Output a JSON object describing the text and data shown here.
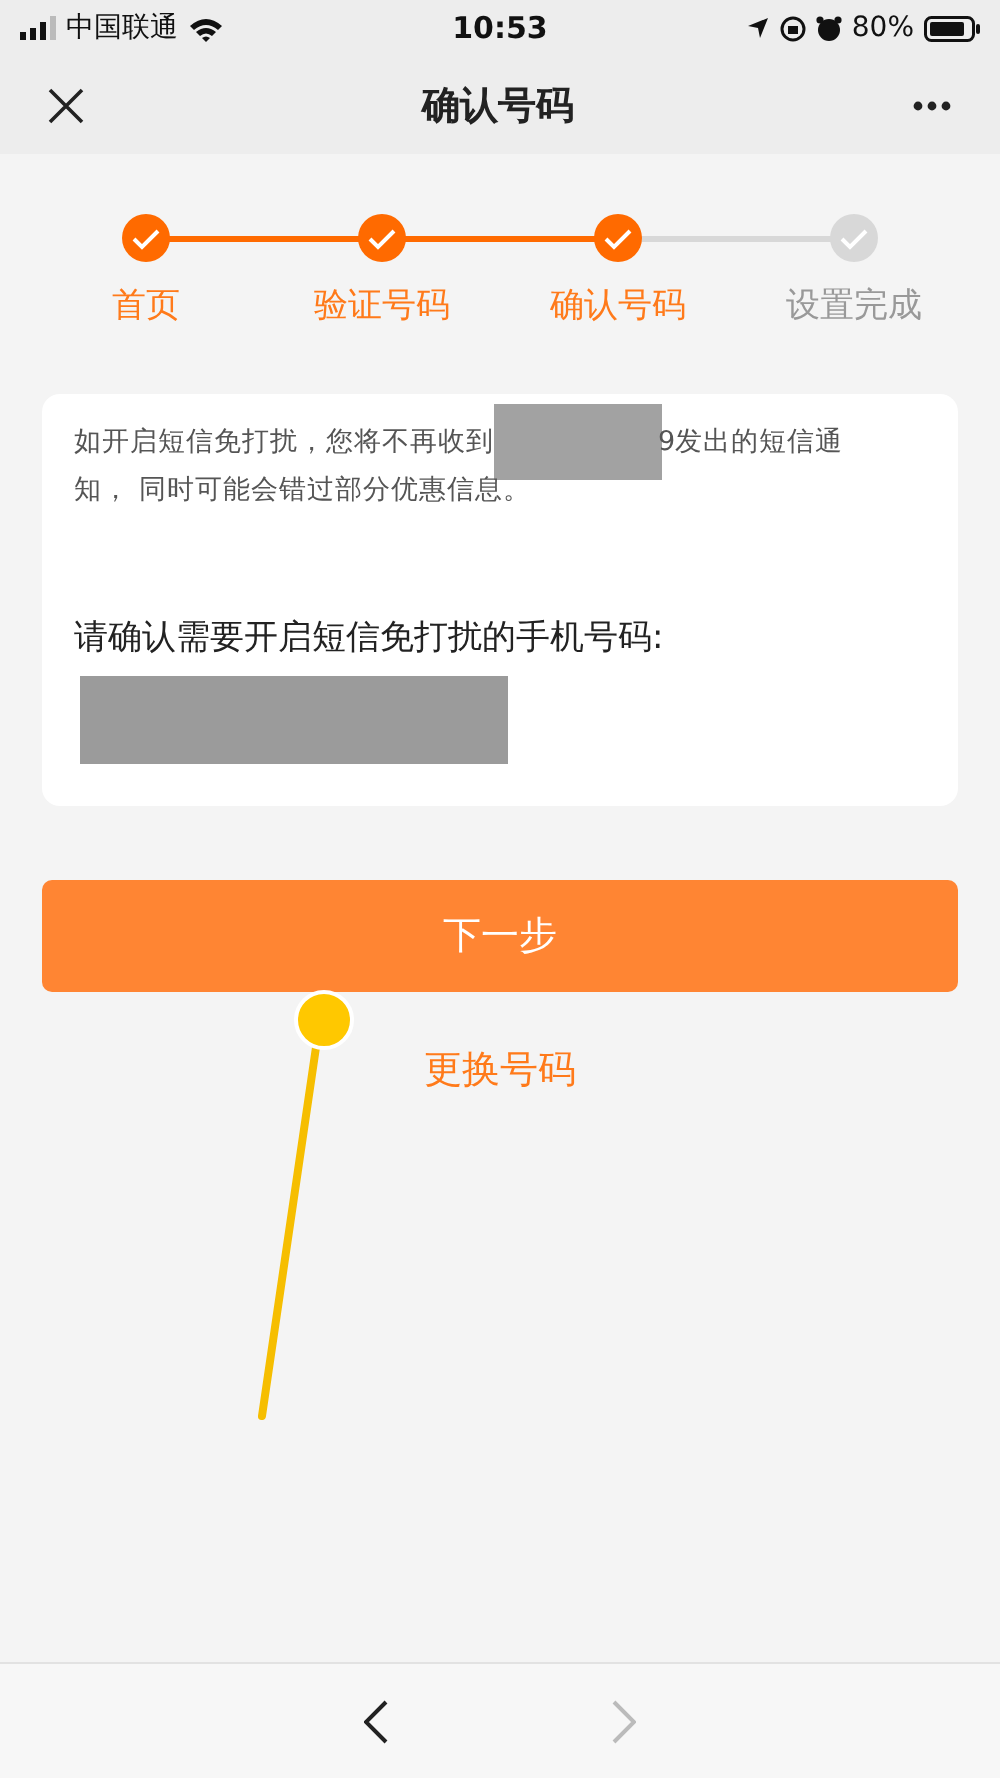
{
  "status_bar": {
    "carrier": "中国联通",
    "time": "10:53",
    "battery": "80%"
  },
  "nav": {
    "title": "确认号码"
  },
  "steps": [
    {
      "label": "首页",
      "done": true
    },
    {
      "label": "验证号码",
      "done": true
    },
    {
      "label": "确认号码",
      "done": true
    },
    {
      "label": "设置完成",
      "done": false
    }
  ],
  "card": {
    "notice_before": "如开启短信免打扰，您将不再收到",
    "notice_after": "9发出的短信通",
    "notice_line2": "知， 同时可能会错过部分优惠信息。",
    "prompt": "请确认需要开启短信免打扰的手机号码:"
  },
  "next_button": "下一步",
  "change_link": "更换号码",
  "toolbar": {
    "back_disabled": false,
    "forward_disabled": true
  }
}
